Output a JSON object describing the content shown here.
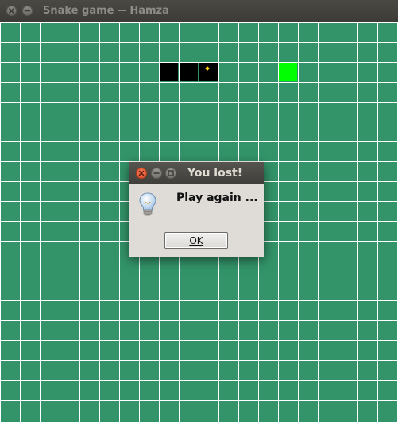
{
  "window": {
    "title": "Snake game -- Hamza",
    "controls": [
      "close-icon",
      "minimize-icon"
    ]
  },
  "board": {
    "background_color": "#339469",
    "grid_color": "#ffffff",
    "snake_color": "#000000",
    "snake_eye_color": "#ffd400",
    "food_color": "#00ff00"
  },
  "dialog": {
    "title": "You lost!",
    "message": "Play again ...",
    "icon": "lightbulb-icon",
    "ok_label": "OK",
    "controls": [
      "close-icon",
      "minimize-icon",
      "maximize-icon"
    ]
  }
}
